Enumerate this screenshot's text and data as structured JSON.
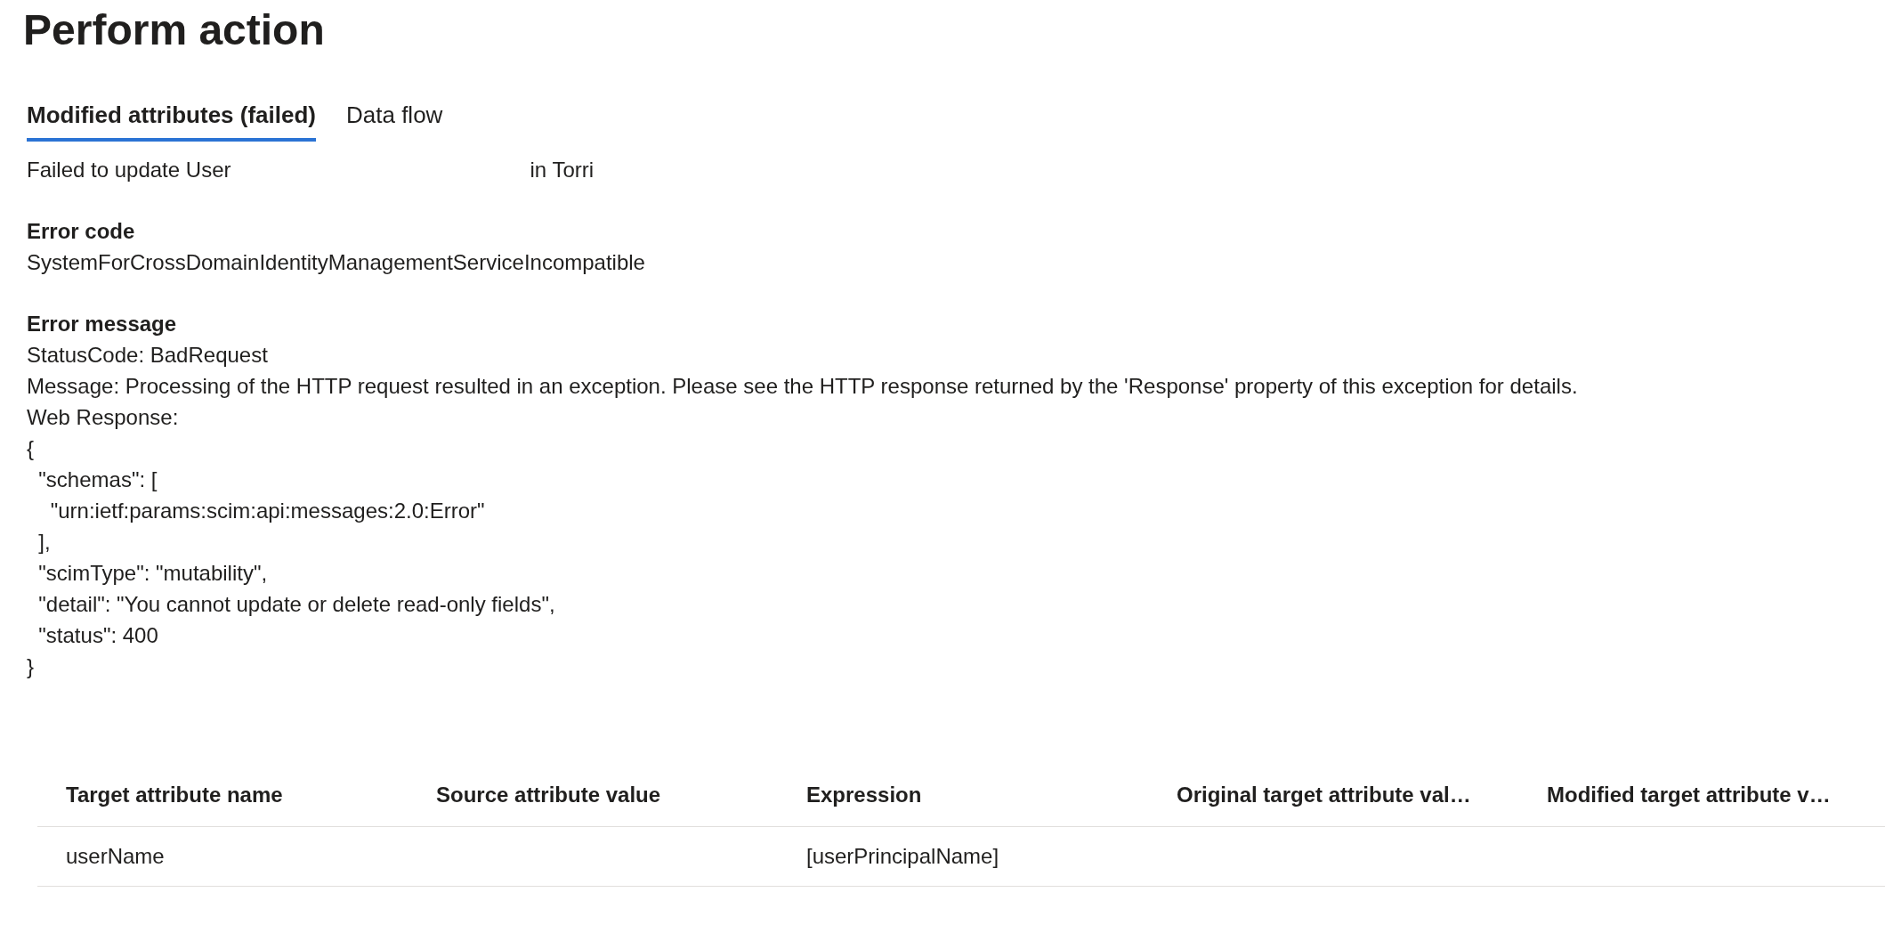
{
  "title": "Perform action",
  "tabs": [
    {
      "label": "Modified attributes (failed)",
      "selected": true
    },
    {
      "label": "Data flow",
      "selected": false
    }
  ],
  "summary": {
    "before": "Failed to update User",
    "after": "in Torri"
  },
  "error_code": {
    "label": "Error code",
    "value": "SystemForCrossDomainIdentityManagementServiceIncompatible"
  },
  "error_message": {
    "label": "Error message",
    "lines": [
      "StatusCode: BadRequest",
      "Message: Processing of the HTTP request resulted in an exception. Please see the HTTP response returned by the 'Response' property of this exception for details.",
      "Web Response:",
      "{",
      "  \"schemas\": [",
      "    \"urn:ietf:params:scim:api:messages:2.0:Error\"",
      "  ],",
      "  \"scimType\": \"mutability\",",
      "  \"detail\": \"You cannot update or delete read-only fields\",",
      "  \"status\": 400",
      "}"
    ]
  },
  "table": {
    "columns": [
      "Target attribute name",
      "Source attribute value",
      "Expression",
      "Original target attribute val…",
      "Modified target attribute v…"
    ],
    "rows": [
      [
        "userName",
        "",
        "[userPrincipalName]",
        "",
        ""
      ]
    ]
  }
}
